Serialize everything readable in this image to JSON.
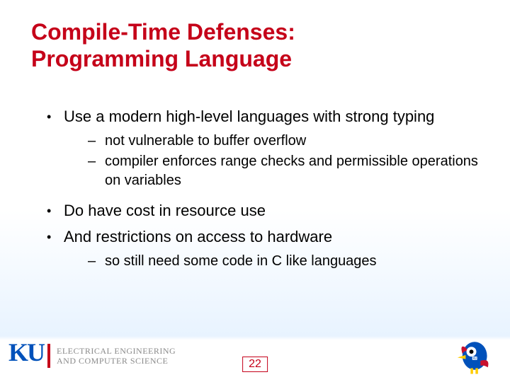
{
  "title_line1": "Compile-Time Defenses:",
  "title_line2": "Programming Language",
  "bullets": {
    "b1": "Use a modern high-level languages with strong typing",
    "b1a": "not vulnerable to buffer overflow",
    "b1b": "compiler enforces range checks and permissible operations on variables",
    "b2": "Do have cost in resource use",
    "b3": "And restrictions on access to hardware",
    "b3a": "so still need some code in C like languages"
  },
  "footer": {
    "ku": "KU",
    "dept_line1": "ELECTRICAL ENGINEERING",
    "dept_line2": "AND COMPUTER SCIENCE",
    "page": "22"
  }
}
